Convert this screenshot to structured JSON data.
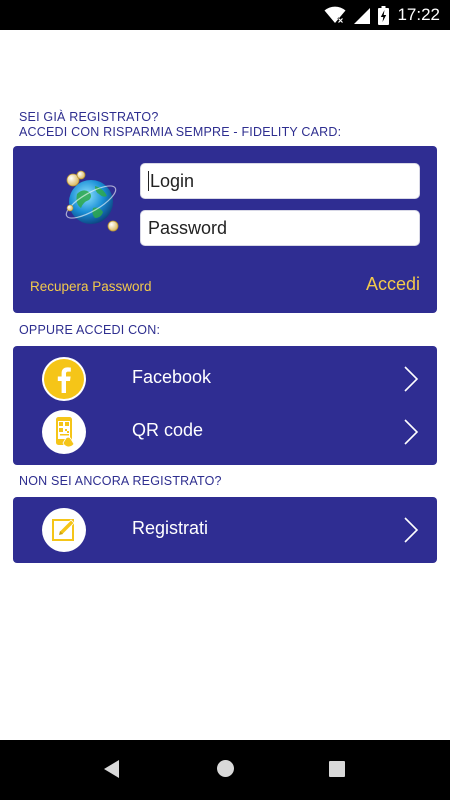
{
  "status_bar": {
    "time": "17:22",
    "icons": [
      "wifi-icon",
      "signal-icon",
      "battery-icon"
    ]
  },
  "login_section": {
    "heading_line1": "SEI GIÀ REGISTRATO?",
    "heading_line2": "ACCEDI CON RISPARMIA SEMPRE - FIDELITY CARD:",
    "login_placeholder": "Login",
    "password_placeholder": "Password",
    "recover_password": "Recupera Password",
    "submit": "Accedi",
    "logo": "globe-logo"
  },
  "alternative_section": {
    "heading": "OPPURE ACCEDI CON:",
    "items": [
      {
        "label": "Facebook",
        "icon": "facebook-icon"
      },
      {
        "label": "QR code",
        "icon": "qr-phone-icon"
      }
    ]
  },
  "register_section": {
    "heading": "NON SEI ANCORA REGISTRATO?",
    "item": {
      "label": "Registrati",
      "icon": "edit-icon"
    }
  },
  "nav_bar": {
    "buttons": [
      "back-icon",
      "home-icon",
      "recents-icon"
    ]
  },
  "colors": {
    "primary": "#2f2d92",
    "accent": "#f2c94c",
    "heading_text": "#2e2e8f"
  }
}
